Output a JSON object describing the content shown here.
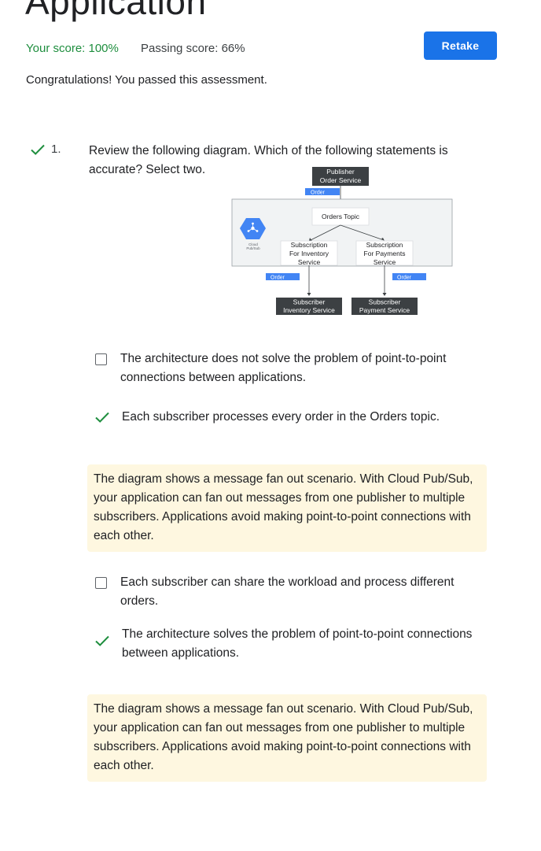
{
  "page": {
    "title": "Application"
  },
  "score": {
    "your_score": "Your score: 100%",
    "passing_score": "Passing score: 66%",
    "retake_label": "Retake",
    "message": "Congratulations! You passed this assessment."
  },
  "question": {
    "number": "1.",
    "status": "correct",
    "text": "Review the following diagram. Which of the following statements is accurate? Select two.",
    "diagram": {
      "publisher": [
        "Publisher",
        "Order Service"
      ],
      "order_tag_top": "Order",
      "topic": "Orders Topic",
      "pubsub_label": [
        "Cloud",
        "Pub/Sub"
      ],
      "subscription_inventory": [
        "Subscription",
        "For Inventory",
        "Service"
      ],
      "subscription_payments": [
        "Subscription",
        "For Payments",
        "Service"
      ],
      "order_tag_left": "Order",
      "order_tag_right": "Order",
      "subscriber_inventory": [
        "Subscriber",
        "Inventory Service"
      ],
      "subscriber_payment": [
        "Subscriber",
        "Payment Service"
      ]
    },
    "options": [
      {
        "label": "The architecture does not solve the problem of point-to-point connections between applications.",
        "selected": false
      },
      {
        "label": "Each subscriber processes every order in the Orders topic.",
        "selected": true,
        "feedback": "The diagram shows a message fan out scenario. With Cloud Pub/Sub, your application can fan out messages from one publisher to multiple subscribers. Applications avoid making point-to-point connections with each other."
      },
      {
        "label": "Each subscriber can share the workload and process different orders.",
        "selected": false
      },
      {
        "label": "The architecture solves the problem of point-to-point connections between applications.",
        "selected": true,
        "feedback": "The diagram shows a message fan out scenario. With Cloud Pub/Sub, your application can fan out messages from one publisher to multiple subscribers. Applications avoid making point-to-point connections with each other."
      }
    ]
  },
  "colors": {
    "accent": "#1a73e8",
    "success": "#1e8e3e",
    "feedback_bg": "#fef7e0",
    "diagram_dark": "#3c4043",
    "diagram_tag": "#4285f4"
  },
  "icons": {
    "check": "check-icon",
    "pubsub": "cloud-pubsub-icon"
  }
}
